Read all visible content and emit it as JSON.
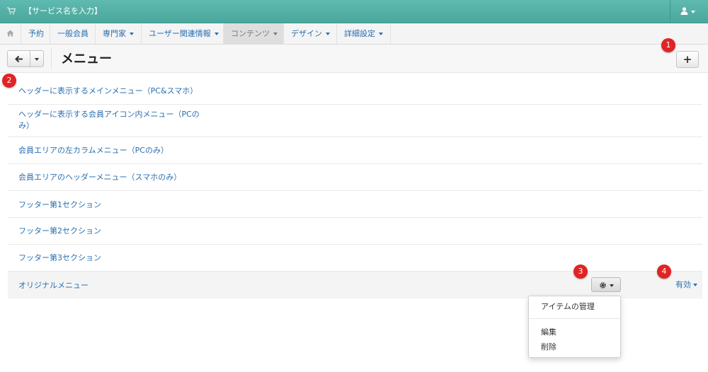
{
  "topbar": {
    "brand": "【サービス名を入力】",
    "accent": "#4fada2"
  },
  "navbar": {
    "items": [
      {
        "label": "予約",
        "has_caret": false
      },
      {
        "label": "一般会員",
        "has_caret": false
      },
      {
        "label": "専門家",
        "has_caret": true
      },
      {
        "label": "ユーザー関連情報",
        "has_caret": true
      },
      {
        "label": "コンテンツ",
        "has_caret": true,
        "active": true
      },
      {
        "label": "デザイン",
        "has_caret": true
      },
      {
        "label": "詳細設定",
        "has_caret": true
      }
    ]
  },
  "header": {
    "title": "メニュー",
    "add_label": "+"
  },
  "menus": [
    "ヘッダーに表示するメインメニュー（PC&スマホ）",
    "ヘッダーに表示する会員アイコン内メニュー（PCのみ）",
    "会員エリアの左カラムメニュー（PCのみ）",
    "会員エリアのヘッダーメニュー（スマホのみ）",
    "フッター第1セクション",
    "フッター第2セクション",
    "フッター第3セクション",
    "オリジナルメニュー"
  ],
  "row_actions": {
    "status_label": "有効"
  },
  "dropdown": {
    "items": [
      "アイテムの管理",
      "編集",
      "削除"
    ]
  },
  "badges": [
    "1",
    "2",
    "3",
    "4"
  ],
  "colors": {
    "link": "#2a6fb0",
    "badge": "#e02424"
  }
}
